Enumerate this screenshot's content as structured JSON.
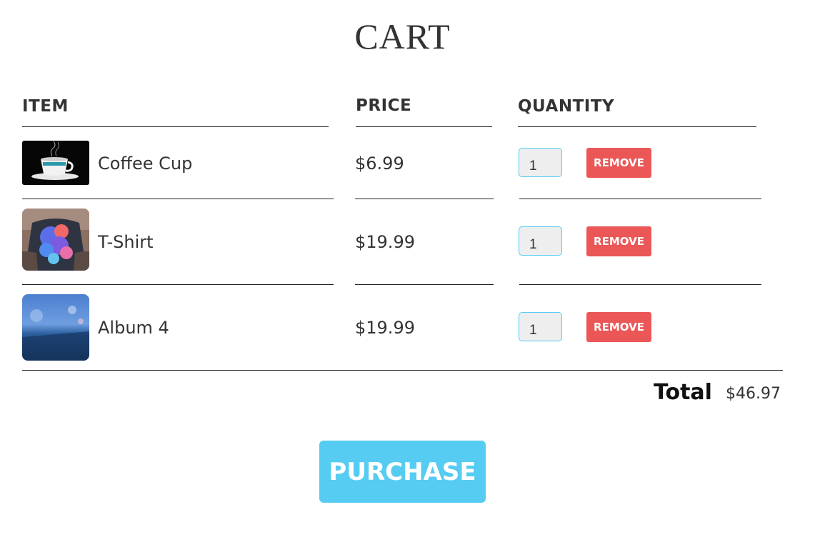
{
  "page": {
    "title": "CART"
  },
  "columns": {
    "item": "ITEM",
    "price": "PRICE",
    "quantity": "QUANTITY"
  },
  "items": [
    {
      "name": "Coffee Cup",
      "price": "$6.99",
      "quantity": "1",
      "remove_label": "REMOVE",
      "image_icon": "coffee-cup-image"
    },
    {
      "name": "T-Shirt",
      "price": "$19.99",
      "quantity": "1",
      "remove_label": "REMOVE",
      "image_icon": "t-shirt-image"
    },
    {
      "name": "Album 4",
      "price": "$19.99",
      "quantity": "1",
      "remove_label": "REMOVE",
      "image_icon": "album-cover-image"
    }
  ],
  "total": {
    "label": "Total",
    "value": "$46.97"
  },
  "purchase": {
    "label": "PURCHASE"
  },
  "colors": {
    "accent": "#56ccf2",
    "remove": "#eb5757",
    "text": "#333333"
  }
}
